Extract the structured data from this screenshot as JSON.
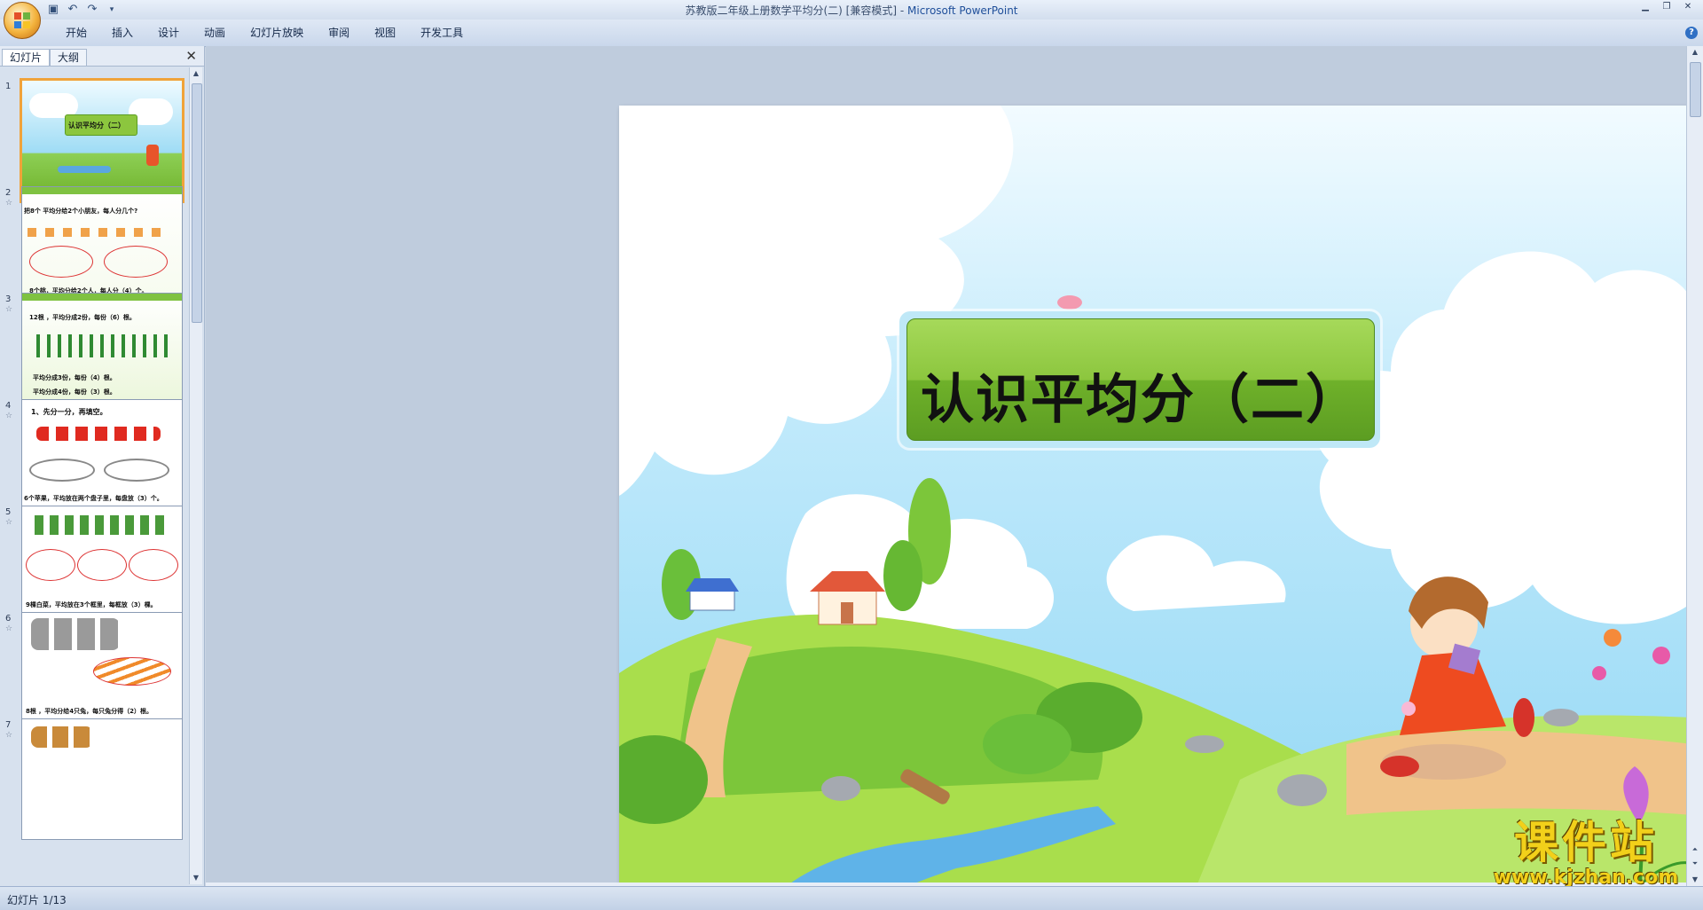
{
  "window": {
    "title_doc": "苏教版二年级上册数学平均分(二) [兼容模式] - ",
    "title_app": "Microsoft PowerPoint"
  },
  "ribbon": {
    "tabs": [
      "开始",
      "插入",
      "设计",
      "动画",
      "幻灯片放映",
      "审阅",
      "视图",
      "开发工具"
    ]
  },
  "panel": {
    "tab_slides": "幻灯片",
    "tab_outline": "大纲",
    "thumbnails": [
      {
        "num": "1",
        "text": "认识平均分（二）"
      },
      {
        "num": "2",
        "text": "把8个  平均分给2个小朋友，每人分几个?",
        "text2": "8个桃，平均分给2个人，每人分（4）个。"
      },
      {
        "num": "3",
        "text": "12根  ，平均分成2份，每份（6）根。",
        "text2": "平均分成3份，每份（4）根。",
        "text3": "平均分成4份，每份（3）根。"
      },
      {
        "num": "4",
        "text": "1、先分一分，再填空。",
        "text2": "6个苹果，平均放在两个盘子里，每盘放（3）个。"
      },
      {
        "num": "5",
        "text": "9棵白菜，平均放在3个框里，每框放（3）棵。"
      },
      {
        "num": "6",
        "text": "8根  ，平均分给4只兔，每只兔分得（2）根。"
      },
      {
        "num": "7",
        "text": ""
      }
    ]
  },
  "slide": {
    "title": "认识平均分（二）"
  },
  "watermark": {
    "cn": "课件站",
    "url": "www.kjzhan.com"
  },
  "status": {
    "slide_counter": "幻灯片 1/13"
  }
}
